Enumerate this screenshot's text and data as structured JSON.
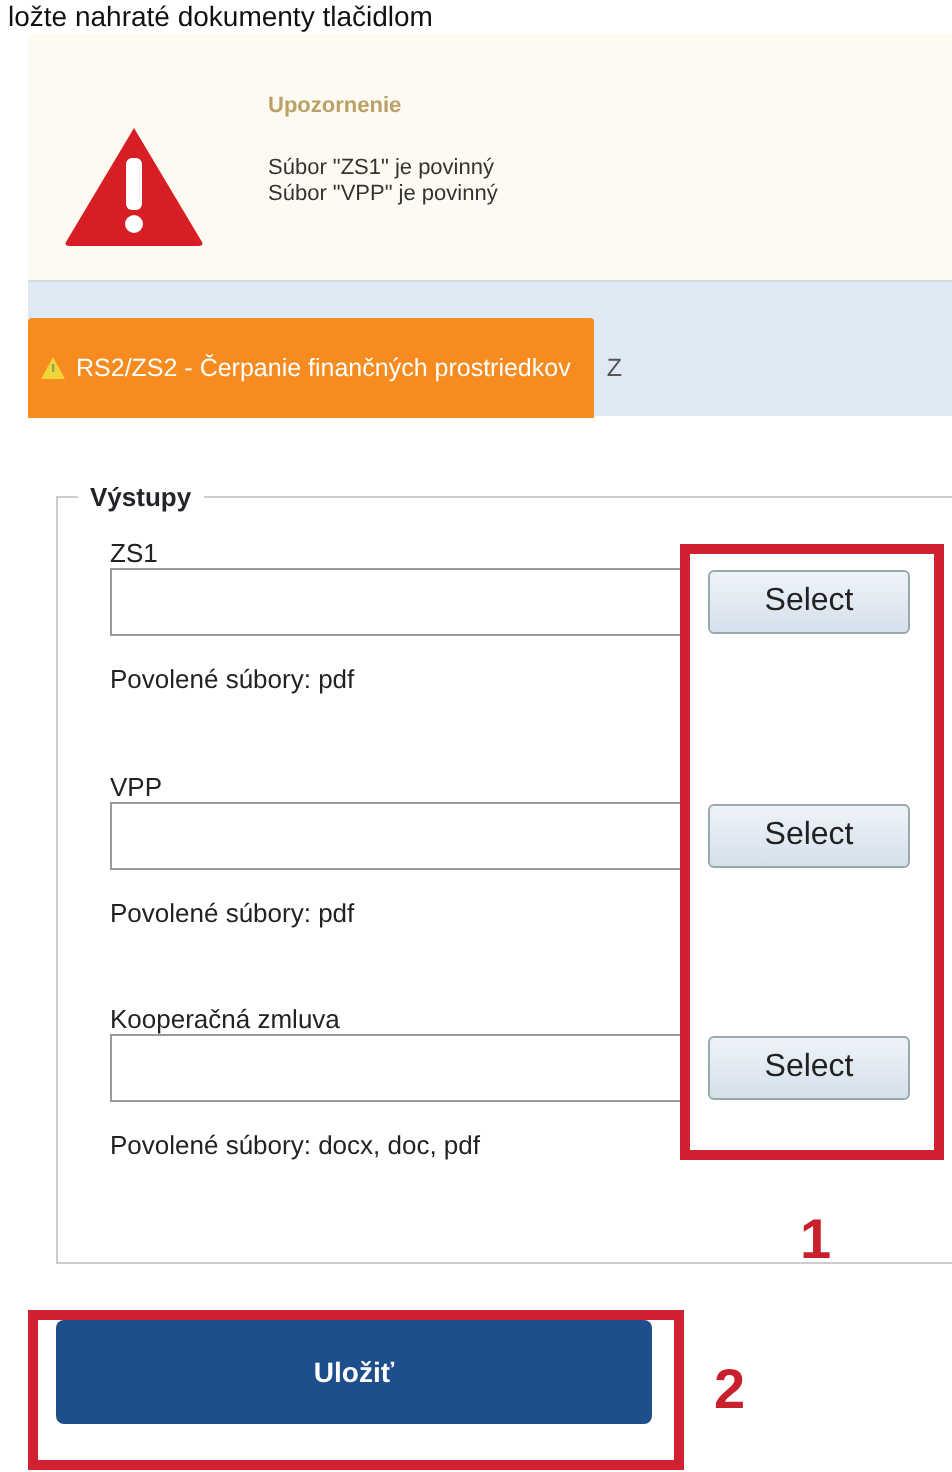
{
  "heading": "ložte nahraté dokumenty tlačidlom",
  "alert": {
    "title": "Upozornenie",
    "messages": [
      "Súbor \"ZS1\" je povinný",
      "Súbor \"VPP\" je povinný"
    ]
  },
  "tabs": [
    {
      "label": "RS2/ZS2 - Čerpanie finančných prostriedkov",
      "selected": true,
      "warning": true
    },
    {
      "label": "Z",
      "selected": false,
      "warning": false
    }
  ],
  "fieldset": {
    "legend": "Výstupy",
    "fields": [
      {
        "label": "ZS1",
        "button": "Select",
        "hint": "Povolené súbory: pdf"
      },
      {
        "label": "VPP",
        "button": "Select",
        "hint": "Povolené súbory: pdf"
      },
      {
        "label": "Kooperačná zmluva",
        "button": "Select",
        "hint": "Povolené súbory: docx, doc, pdf"
      }
    ]
  },
  "save_button": "Uložiť",
  "annotations": [
    {
      "number": "1"
    },
    {
      "number": "2"
    }
  ]
}
